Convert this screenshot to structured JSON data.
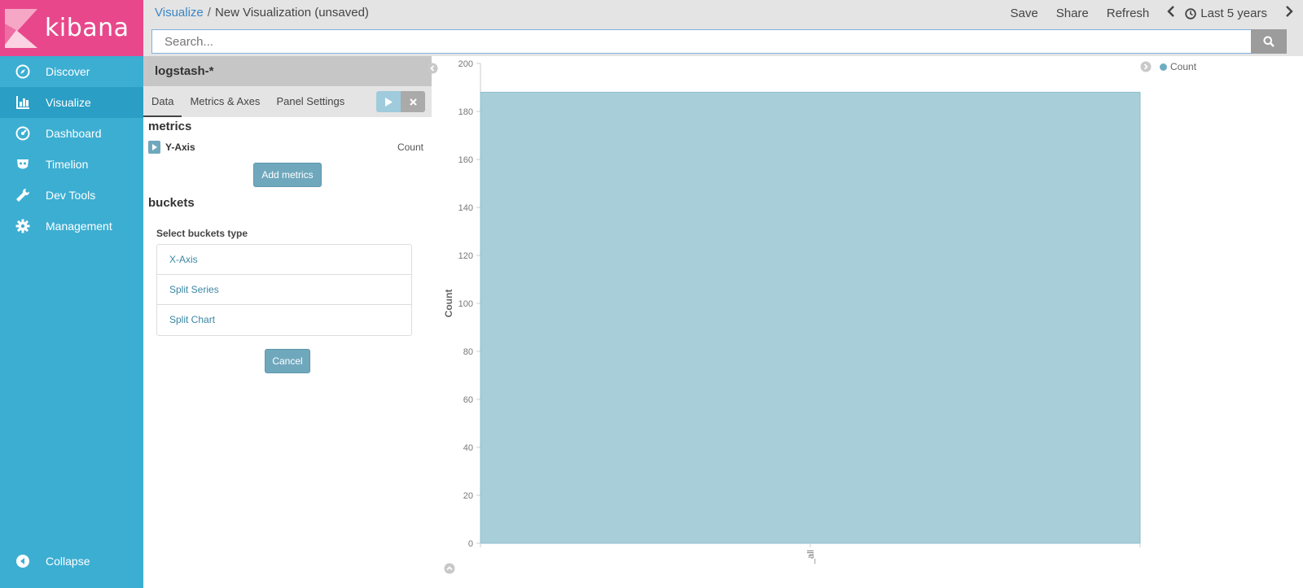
{
  "app": {
    "logo_text": "kibana"
  },
  "sidebar": {
    "items": [
      {
        "label": "Discover",
        "icon": "compass-icon"
      },
      {
        "label": "Visualize",
        "icon": "bar-chart-icon",
        "active": true
      },
      {
        "label": "Dashboard",
        "icon": "dashboard-icon"
      },
      {
        "label": "Timelion",
        "icon": "timelion-icon"
      },
      {
        "label": "Dev Tools",
        "icon": "wrench-icon"
      },
      {
        "label": "Management",
        "icon": "gear-icon"
      }
    ],
    "collapse_label": "Collapse"
  },
  "topbar": {
    "breadcrumb_link": "Visualize",
    "breadcrumb_sep": "/",
    "breadcrumb_current": "New Visualization (unsaved)",
    "save": "Save",
    "share": "Share",
    "refresh": "Refresh",
    "time_range": "Last 5 years"
  },
  "search": {
    "placeholder": "Search..."
  },
  "editor": {
    "index_pattern": "logstash-*",
    "tabs": [
      "Data",
      "Metrics & Axes",
      "Panel Settings"
    ],
    "metrics_heading": "metrics",
    "metric_name": "Y-Axis",
    "metric_value": "Count",
    "add_metrics": "Add metrics",
    "buckets_heading": "buckets",
    "select_buckets_label": "Select buckets type",
    "bucket_types": [
      "X-Axis",
      "Split Series",
      "Split Chart"
    ],
    "cancel": "Cancel"
  },
  "colors": {
    "sidebar": "#3caed2",
    "logo_bg": "#e8488b",
    "bar": "#a8ced9",
    "accent": "#6fa8bd"
  },
  "chart_data": {
    "type": "bar",
    "categories": [
      "_all"
    ],
    "series": [
      {
        "name": "Count",
        "values": [
          188
        ]
      }
    ],
    "xlabel": "",
    "ylabel": "Count",
    "ylim": [
      0,
      200
    ],
    "yticks": [
      0,
      20,
      40,
      60,
      80,
      100,
      120,
      140,
      160,
      180,
      200
    ],
    "legend": "top-right",
    "grid": false
  }
}
